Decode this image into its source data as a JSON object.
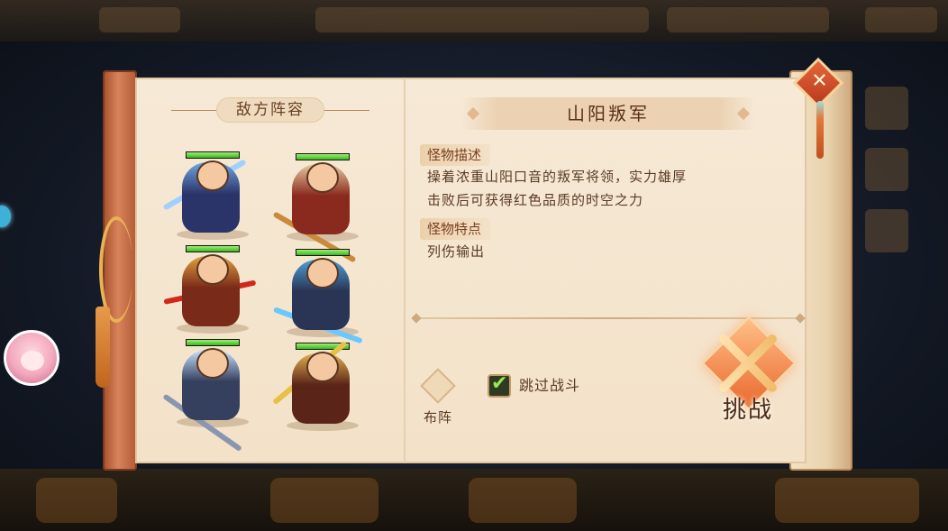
{
  "dialog": {
    "enemy_lineup_title": "敌方阵容",
    "monster_name": "山阳叛军",
    "description_tag": "怪物描述",
    "description_lines": [
      "操着浓重山阳口音的叛军将领，实力雄厚",
      "击败后可获得红色品质的时空之力"
    ],
    "traits_tag": "怪物特点",
    "traits_text": "列伤输出",
    "formation_label": "布阵",
    "skip_battle_label": "跳过战斗",
    "skip_battle_checked": true,
    "challenge_label": "挑战",
    "close_icon": "close-icon"
  },
  "enemies": [
    {
      "hp": 1.0,
      "colors": {
        "body": "#2b3468",
        "accent": "#6fa8e0",
        "weapon": "#9fd0ff"
      }
    },
    {
      "hp": 1.0,
      "colors": {
        "body": "#8a2a1e",
        "accent": "#e8c9a0",
        "weapon": "#c98a3a"
      }
    },
    {
      "hp": 1.0,
      "colors": {
        "body": "#7a2a18",
        "accent": "#e0a040",
        "weapon": "#d0281c"
      }
    },
    {
      "hp": 1.0,
      "colors": {
        "body": "#2a3454",
        "accent": "#4aa0d8",
        "weapon": "#6ac8ff"
      }
    },
    {
      "hp": 1.0,
      "colors": {
        "body": "#34405e",
        "accent": "#c8e0ff",
        "weapon": "#8a96b0"
      }
    },
    {
      "hp": 1.0,
      "colors": {
        "body": "#5a2418",
        "accent": "#e0b050",
        "weapon": "#e8c048"
      }
    }
  ]
}
